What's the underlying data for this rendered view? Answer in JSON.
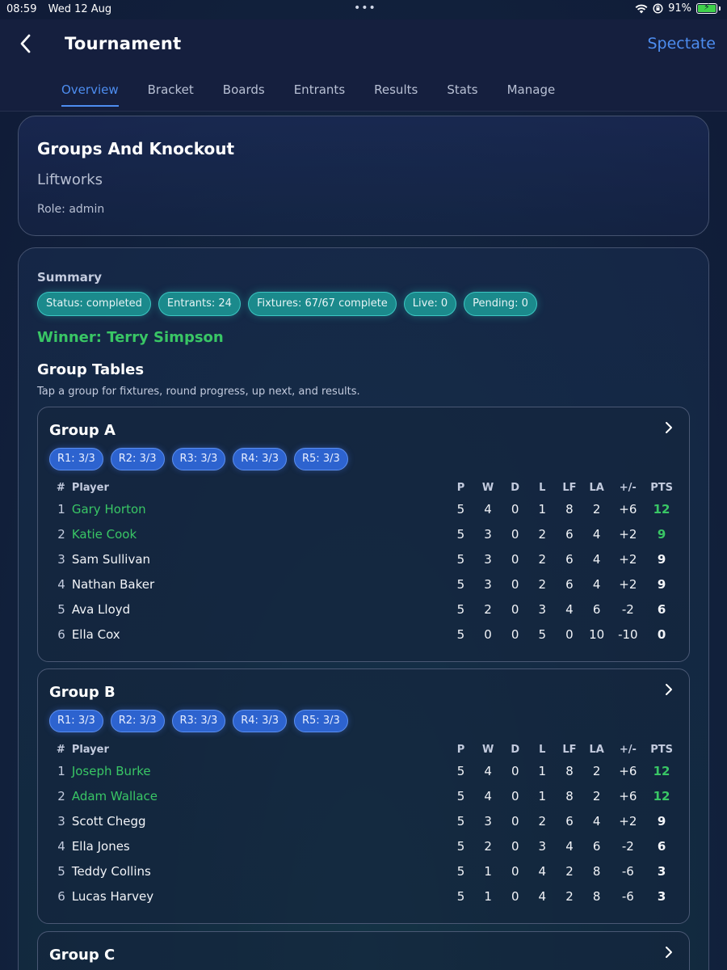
{
  "status_bar": {
    "time": "08:59",
    "date": "Wed 12 Aug",
    "battery": "91%",
    "battery_color": "#3fd14b"
  },
  "header": {
    "title": "Tournament",
    "spectate_label": "Spectate",
    "accent_color": "#4d8df0",
    "tabs": [
      {
        "label": "Overview",
        "active": true
      },
      {
        "label": "Bracket",
        "active": false
      },
      {
        "label": "Boards",
        "active": false
      },
      {
        "label": "Entrants",
        "active": false
      },
      {
        "label": "Results",
        "active": false
      },
      {
        "label": "Stats",
        "active": false
      },
      {
        "label": "Manage",
        "active": false
      }
    ]
  },
  "info": {
    "title": "Groups And Knockout",
    "venue": "Liftworks",
    "role": "Role: admin"
  },
  "summary": {
    "label": "Summary",
    "chips": [
      "Status: completed",
      "Entrants: 24",
      "Fixtures: 67/67 complete",
      "Live: 0",
      "Pending: 0"
    ],
    "winner": "Winner: Terry Simpson",
    "winner_color": "#39c665"
  },
  "group_tables": {
    "title": "Group Tables",
    "subtitle": "Tap a group for fixtures, round progress, up next, and results.",
    "columns": [
      "#",
      "Player",
      "P",
      "W",
      "D",
      "L",
      "LF",
      "LA",
      "+/-",
      "PTS"
    ],
    "groups": [
      {
        "name": "Group A",
        "rounds": [
          "R1: 3/3",
          "R2: 3/3",
          "R3: 3/3",
          "R4: 3/3",
          "R5: 3/3"
        ],
        "rows": [
          {
            "pos": "1",
            "player": "Gary Horton",
            "p": "5",
            "w": "4",
            "d": "0",
            "l": "1",
            "lf": "8",
            "la": "2",
            "diff": "+6",
            "pts": "12",
            "qualified": true
          },
          {
            "pos": "2",
            "player": "Katie Cook",
            "p": "5",
            "w": "3",
            "d": "0",
            "l": "2",
            "lf": "6",
            "la": "4",
            "diff": "+2",
            "pts": "9",
            "qualified": true
          },
          {
            "pos": "3",
            "player": "Sam Sullivan",
            "p": "5",
            "w": "3",
            "d": "0",
            "l": "2",
            "lf": "6",
            "la": "4",
            "diff": "+2",
            "pts": "9",
            "qualified": false
          },
          {
            "pos": "4",
            "player": "Nathan Baker",
            "p": "5",
            "w": "3",
            "d": "0",
            "l": "2",
            "lf": "6",
            "la": "4",
            "diff": "+2",
            "pts": "9",
            "qualified": false
          },
          {
            "pos": "5",
            "player": "Ava Lloyd",
            "p": "5",
            "w": "2",
            "d": "0",
            "l": "3",
            "lf": "4",
            "la": "6",
            "diff": "-2",
            "pts": "6",
            "qualified": false
          },
          {
            "pos": "6",
            "player": "Ella Cox",
            "p": "5",
            "w": "0",
            "d": "0",
            "l": "5",
            "lf": "0",
            "la": "10",
            "diff": "-10",
            "pts": "0",
            "qualified": false
          }
        ]
      },
      {
        "name": "Group B",
        "rounds": [
          "R1: 3/3",
          "R2: 3/3",
          "R3: 3/3",
          "R4: 3/3",
          "R5: 3/3"
        ],
        "rows": [
          {
            "pos": "1",
            "player": "Joseph Burke",
            "p": "5",
            "w": "4",
            "d": "0",
            "l": "1",
            "lf": "8",
            "la": "2",
            "diff": "+6",
            "pts": "12",
            "qualified": true
          },
          {
            "pos": "2",
            "player": "Adam Wallace",
            "p": "5",
            "w": "4",
            "d": "0",
            "l": "1",
            "lf": "8",
            "la": "2",
            "diff": "+6",
            "pts": "12",
            "qualified": true
          },
          {
            "pos": "3",
            "player": "Scott Chegg",
            "p": "5",
            "w": "3",
            "d": "0",
            "l": "2",
            "lf": "6",
            "la": "4",
            "diff": "+2",
            "pts": "9",
            "qualified": false
          },
          {
            "pos": "4",
            "player": "Ella Jones",
            "p": "5",
            "w": "2",
            "d": "0",
            "l": "3",
            "lf": "4",
            "la": "6",
            "diff": "-2",
            "pts": "6",
            "qualified": false
          },
          {
            "pos": "5",
            "player": "Teddy Collins",
            "p": "5",
            "w": "1",
            "d": "0",
            "l": "4",
            "lf": "2",
            "la": "8",
            "diff": "-6",
            "pts": "3",
            "qualified": false
          },
          {
            "pos": "6",
            "player": "Lucas Harvey",
            "p": "5",
            "w": "1",
            "d": "0",
            "l": "4",
            "lf": "2",
            "la": "8",
            "diff": "-6",
            "pts": "3",
            "qualified": false
          }
        ]
      },
      {
        "name": "Group C"
      }
    ]
  }
}
